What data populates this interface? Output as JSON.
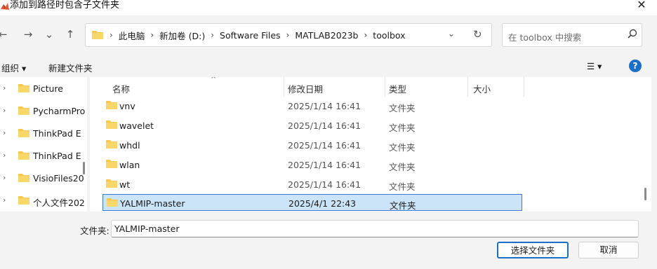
{
  "window": {
    "title": "添加到路径时包含子文件夹",
    "close_glyph": "✕"
  },
  "nav": {
    "back_glyph": "←",
    "forward_glyph": "→",
    "recent_glyph": "⌄",
    "up_glyph": "↑"
  },
  "address": {
    "crumbs": [
      "此电脑",
      "新加卷 (D:)",
      "Software Files",
      "MATLAB2023b",
      "toolbox"
    ],
    "separator": "›",
    "dropdown_glyph": "⌄",
    "refresh_glyph": "↻"
  },
  "search": {
    "placeholder": "在 toolbox 中搜索"
  },
  "toolbar": {
    "organize_label": "组织 ▾",
    "new_folder_label": "新建文件夹",
    "view_glyph": "☰ ▾",
    "help_glyph": "?"
  },
  "sidebar": {
    "items": [
      {
        "label": "Picture"
      },
      {
        "label": "PycharmPro"
      },
      {
        "label": "ThinkPad E"
      },
      {
        "label": "ThinkPad E"
      },
      {
        "label": "VisioFiles20"
      },
      {
        "label": "个人文件202"
      }
    ],
    "chevron_glyph": "›"
  },
  "columns": {
    "name": "名称",
    "modified": "修改日期",
    "type": "类型",
    "size": "大小",
    "sort_glyph": "^"
  },
  "files": [
    {
      "name": "vnv",
      "modified": "2025/1/14 16:41",
      "type": "文件夹"
    },
    {
      "name": "wavelet",
      "modified": "2025/1/14 16:41",
      "type": "文件夹"
    },
    {
      "name": "whdl",
      "modified": "2025/1/14 16:41",
      "type": "文件夹"
    },
    {
      "name": "wlan",
      "modified": "2025/1/14 16:41",
      "type": "文件夹"
    },
    {
      "name": "wt",
      "modified": "2025/1/14 16:41",
      "type": "文件夹"
    },
    {
      "name": "YALMIP-master",
      "modified": "2025/4/1 22:43",
      "type": "文件夹",
      "selected": true
    }
  ],
  "footer": {
    "folder_label": "文件夹:",
    "folder_value": "YALMIP-master",
    "select_button": "选择文件夹",
    "cancel_button": "取消"
  },
  "colors": {
    "accent": "#1a6fc9",
    "selection_bg": "#cce4f7",
    "folder": "#f7c948"
  }
}
